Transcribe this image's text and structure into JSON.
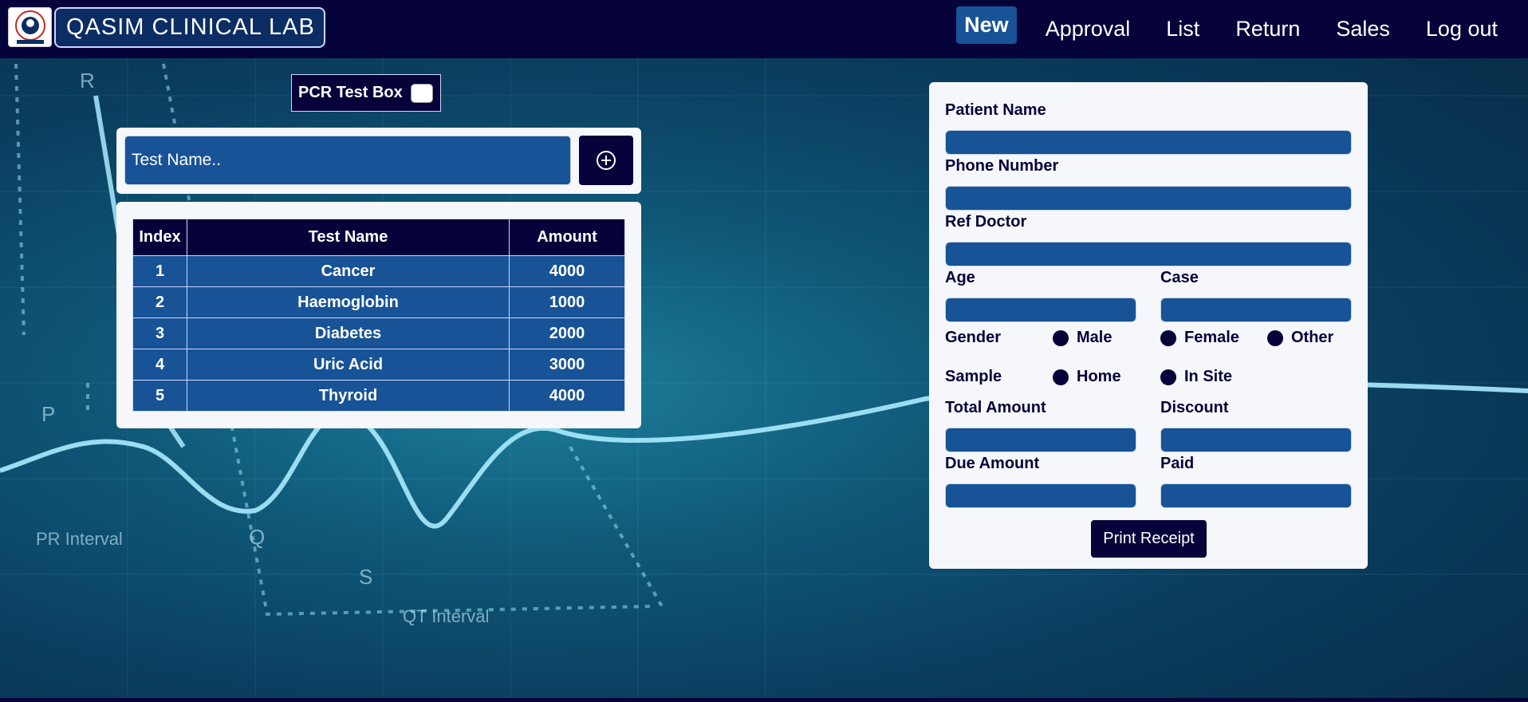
{
  "header": {
    "brand": "QASIM CLINICAL LAB",
    "nav": [
      "New",
      "Approval",
      "List",
      "Return",
      "Sales",
      "Log out"
    ]
  },
  "pcr": {
    "label": "PCR Test Box"
  },
  "test_search": {
    "placeholder": "Test Name.."
  },
  "tests_table": {
    "headers": [
      "Index",
      "Test Name",
      "Amount"
    ],
    "rows": [
      [
        "1",
        "Cancer",
        "4000"
      ],
      [
        "2",
        "Haemoglobin",
        "1000"
      ],
      [
        "3",
        "Diabetes",
        "2000"
      ],
      [
        "4",
        "Uric Acid",
        "3000"
      ],
      [
        "5",
        "Thyroid",
        "4000"
      ]
    ]
  },
  "form": {
    "patient_name": "Patient Name",
    "phone_number": "Phone Number",
    "ref_doctor": "Ref Doctor",
    "age": "Age",
    "case": "Case",
    "gender": "Gender",
    "gender_options": [
      "Male",
      "Female",
      "Other"
    ],
    "sample": "Sample",
    "sample_options": [
      "Home",
      "In Site"
    ],
    "total_amount": "Total Amount",
    "discount": "Discount",
    "due_amount": "Due Amount",
    "paid": "Paid",
    "print_button": "Print Receipt"
  },
  "colors": {
    "navy": "#06023a",
    "field_blue": "#175396",
    "panel": "#f5f7fa"
  }
}
